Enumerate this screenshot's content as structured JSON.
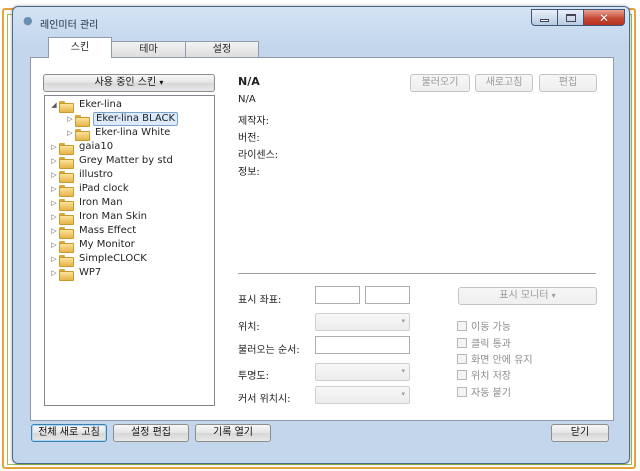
{
  "window": {
    "title": "레인미터 관리"
  },
  "tabs": [
    {
      "label": "스킨",
      "active": true
    },
    {
      "label": "테마",
      "active": false
    },
    {
      "label": "설정",
      "active": false
    }
  ],
  "skins": {
    "dropdown_label": "사용 중인 스킨",
    "dropdown_arrow": "▾",
    "tree": [
      {
        "label": "Eker-lina",
        "expanded": true,
        "level": 0
      },
      {
        "label": "Eker-lina BLACK",
        "level": 1,
        "selected": true
      },
      {
        "label": "Eker-lina White",
        "level": 1
      },
      {
        "label": "gaia10",
        "level": 0
      },
      {
        "label": "Grey Matter by std",
        "level": 0
      },
      {
        "label": "illustro",
        "level": 0
      },
      {
        "label": "iPad clock",
        "level": 0
      },
      {
        "label": "Iron Man",
        "level": 0
      },
      {
        "label": "Iron Man Skin",
        "level": 0
      },
      {
        "label": "Mass Effect",
        "level": 0
      },
      {
        "label": "My Monitor",
        "level": 0
      },
      {
        "label": "SimpleCLOCK",
        "level": 0
      },
      {
        "label": "WP7",
        "level": 0
      }
    ]
  },
  "details": {
    "name": "N/A",
    "value": "N/A",
    "author_label": "제작자:",
    "version_label": "버전:",
    "license_label": "라이센스:",
    "info_label": "정보:",
    "load_button": "불러오기",
    "refresh_button": "새로고침",
    "edit_button": "편집"
  },
  "settings": {
    "coordinates_label": "표시 좌표:",
    "monitor_button": "표시 모니터",
    "monitor_arrow": "▾",
    "position_label": "위치:",
    "load_order_label": "불러오는 순서:",
    "transparency_label": "투명도:",
    "cursor_label": "커서 위치시:",
    "combo_arrow": "▾",
    "checkboxes": [
      {
        "label": "이동 가능",
        "checked": false
      },
      {
        "label": "클릭 통과",
        "checked": false
      },
      {
        "label": "화면 안에 유지",
        "checked": false
      },
      {
        "label": "위치 저장",
        "checked": false
      },
      {
        "label": "자동 붙기",
        "checked": false
      }
    ]
  },
  "footer": {
    "refresh_all": "전체 새로 고침",
    "edit_settings": "설정 편집",
    "open_log": "기록 열기",
    "close": "닫기"
  }
}
